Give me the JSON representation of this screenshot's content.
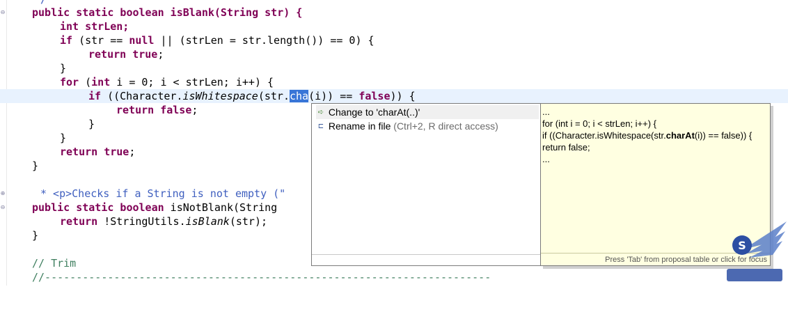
{
  "code": {
    "line_top": "/",
    "line1": "public static boolean isBlank(String str) {",
    "line2": "int strLen;",
    "line3a": "if",
    "line3b": " (str == ",
    "line3c": "null",
    "line3d": " || (strLen = str.length()) == 0) {",
    "line4a": "return",
    "line4b": "true",
    "line5": "}",
    "line6a": "for",
    "line6b": " (",
    "line6c": "int",
    "line6d": " i = 0; i < strLen; i++) {",
    "line7a": "if",
    "line7b": " ((Character.",
    "line7c": "isWhitespace",
    "line7d": "(str.",
    "line7sel": "cha",
    "line7e": "(i)) == ",
    "line7f": "false",
    "line7g": ")) {",
    "line8a": "return",
    "line8b": "false",
    "line9": "}",
    "line10": "}",
    "line11a": "return",
    "line11b": "true",
    "line12": "}",
    "line14": "* <p>Checks if a String is not empty (\"",
    "line15a": "public static boolean",
    "line15b": " isNotBlank(String",
    "line16a": "return",
    "line16b": " !StringUtils.",
    "line16c": "isBlank",
    "line16d": "(str);",
    "line17": "}",
    "line19": "// Trim",
    "line20": "//-----------------------------------------------------------------------"
  },
  "quickfix": {
    "items": [
      {
        "label": "Change to 'charAt(..)'",
        "hint": "",
        "icon": "change-method-icon"
      },
      {
        "label": "Rename in file",
        "hint": " (Ctrl+2, R direct access)",
        "icon": "rename-icon"
      }
    ]
  },
  "preview": {
    "l1": "...",
    "l2": "for (int i = 0; i < strLen; i++) {",
    "l3a": "if ((Character.isWhitespace(str.",
    "l3b": "charAt",
    "l3c": "(i)) == false)) {",
    "l4": "return false;",
    "l5": "...",
    "footer": "Press 'Tab' from proposal table or click for focus"
  },
  "colors": {
    "keyword": "#7f0055",
    "comment": "#3f5fbf",
    "selection": "#3875d7",
    "current_line": "#e8f2fe",
    "preview_bg": "#ffffe1"
  }
}
